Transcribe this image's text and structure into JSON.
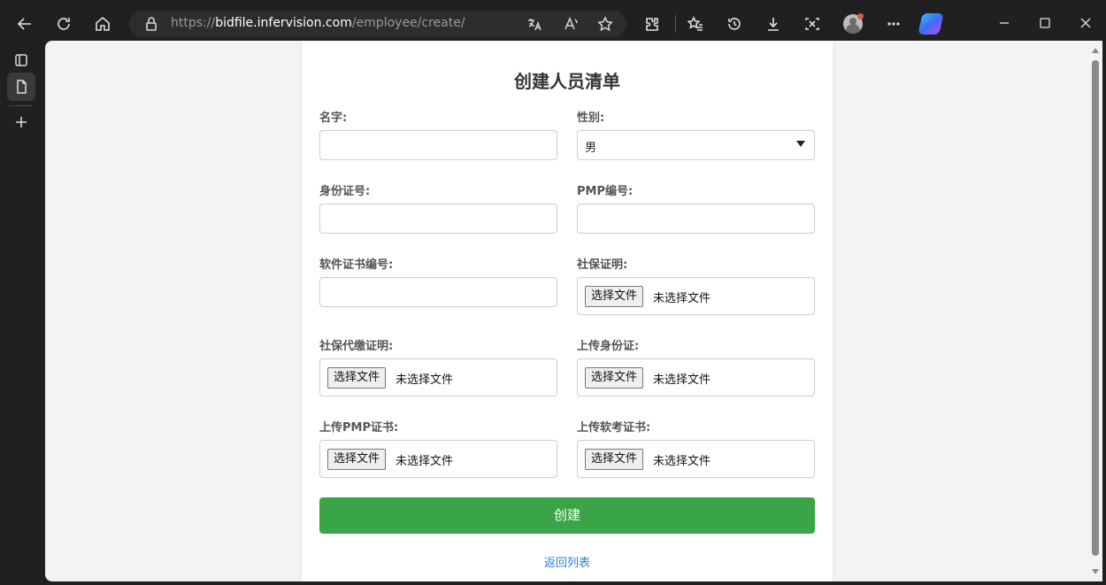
{
  "browser": {
    "url_prefix": "https://",
    "url_host": "bidfile.infervision.com",
    "url_path": "/employee/create/",
    "icons": [
      "back-icon",
      "refresh-icon",
      "home-icon",
      "lock-icon",
      "translate-icon",
      "read-aloud-icon",
      "favorite-icon",
      "extensions-icon",
      "favorites-icon",
      "history-icon",
      "download-icon",
      "screenshot-icon",
      "profile-icon",
      "more-icon",
      "copilot-icon",
      "minimize-icon",
      "maximize-icon",
      "close-icon"
    ]
  },
  "sidebar": {
    "icons": [
      "tab-actions-icon",
      "page-icon",
      "new-tab-icon"
    ]
  },
  "form": {
    "title": "创建人员清单",
    "fields": {
      "name": {
        "label": "名字:",
        "value": ""
      },
      "gender": {
        "label": "性别:",
        "value": "男"
      },
      "id_number": {
        "label": "身份证号:",
        "value": ""
      },
      "pmp_number": {
        "label": "PMP编号:",
        "value": ""
      },
      "soft_cert_number": {
        "label": "软件证书编号:",
        "value": ""
      },
      "social_security_proof": {
        "label": "社保证明:",
        "button": "选择文件",
        "status": "未选择文件"
      },
      "social_security_agent_proof": {
        "label": "社保代缴证明:",
        "button": "选择文件",
        "status": "未选择文件"
      },
      "id_upload": {
        "label": "上传身份证:",
        "button": "选择文件",
        "status": "未选择文件"
      },
      "pmp_upload": {
        "label": "上传PMP证书:",
        "button": "选择文件",
        "status": "未选择文件"
      },
      "soft_exam_upload": {
        "label": "上传软考证书:",
        "button": "选择文件",
        "status": "未选择文件"
      }
    },
    "submit_label": "创建",
    "back_link": "返回列表"
  },
  "colors": {
    "submit": "#3aa547",
    "link": "#2f7bd8"
  }
}
